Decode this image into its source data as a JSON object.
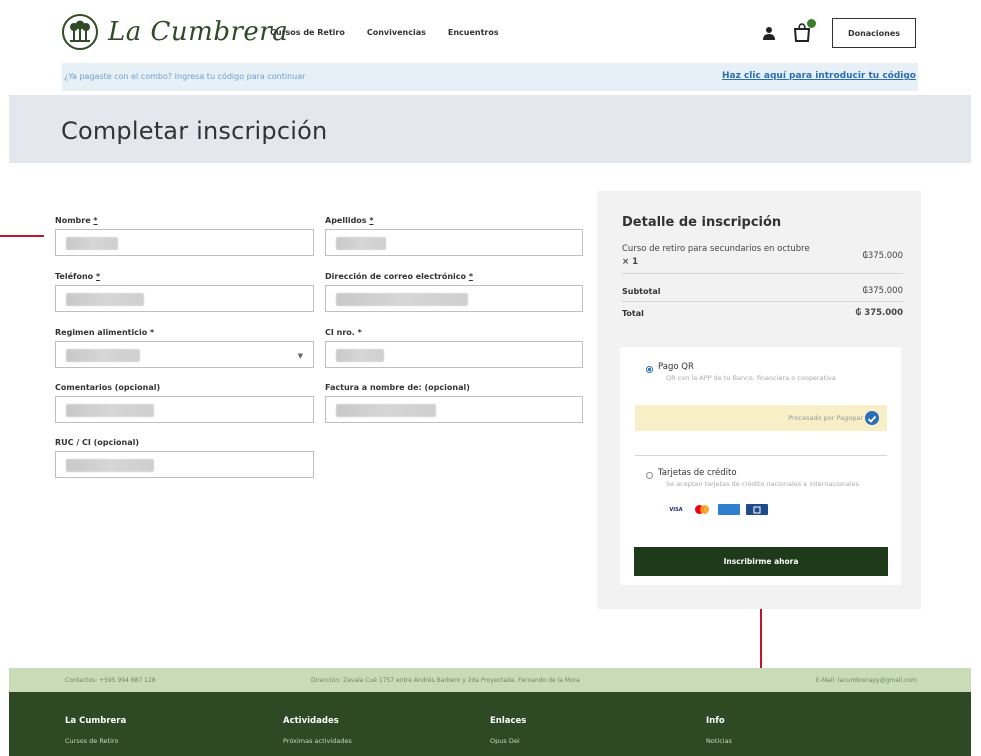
{
  "header": {
    "logo_text": "La Cumbrera",
    "nav": [
      "Cursos de Retiro",
      "Convivencias",
      "Encuentros"
    ],
    "donate_label": "Donaciones"
  },
  "infobar": {
    "message": "¿Ya pagaste con el combo? Ingresa tu código para continuar",
    "link": "Haz clic aquí para introducir tu código"
  },
  "page": {
    "title": "Completar inscripción"
  },
  "form": {
    "fields": [
      {
        "label": "Nombre",
        "required": true
      },
      {
        "label": "Apellidos",
        "required": true
      },
      {
        "label": "Teléfono",
        "required": true
      },
      {
        "label": "Dirección de correo electrónico",
        "required": true
      },
      {
        "label": "Regimen alimenticio",
        "required": true
      },
      {
        "label": "CI nro.",
        "required": true
      },
      {
        "label": "Comentarios (opcional)",
        "required": false
      },
      {
        "label": "Factura a nombre de: (opcional)",
        "required": false
      },
      {
        "label": "RUC / CI (opcional)",
        "required": false
      }
    ],
    "required_mark": "*",
    "select_arrow": "▼"
  },
  "summary": {
    "title": "Detalle de inscripción",
    "item_name": "Curso de retiro para secundarios en octubre",
    "item_qty": "× 1",
    "item_price": "₲375.000",
    "subtotal_label": "Subtotal",
    "subtotal_value": "₲375.000",
    "total_label": "Total",
    "total_value": "₲ 375.000"
  },
  "payment": {
    "options": [
      {
        "title": "Pago QR",
        "description": "QR con la APP de tu Banco, financiera o cooperativa",
        "selected": true
      },
      {
        "title": "Tarjetas de crédito",
        "description": "Se aceptan tarjetas de crédito nacionales e internacionales",
        "selected": false
      }
    ],
    "provider_text": "Procesado por Pagopar",
    "card_brands": [
      "VISA",
      "mastercard",
      "american express",
      "bancard"
    ],
    "submit_label": "Inscribirme ahora"
  },
  "footer": {
    "contact": "Contactos: +595 994 887 128",
    "address": "Dirección: Zavala Cué 1757 entre Andrés Barbero y 2da Proyectada. Fernando de la Mora",
    "email": "E-Mail: lacumbrerapy@gmail.com",
    "columns": [
      {
        "heading": "La Cumbrera",
        "link": "Cursos de Retiro"
      },
      {
        "heading": "Actividades",
        "link": "Próximas actividades"
      },
      {
        "heading": "Enlaces",
        "link": "Opus Dei"
      },
      {
        "heading": "Info",
        "link": "Noticias"
      }
    ]
  },
  "colors": {
    "brand_green": "#2d4a24",
    "button_dark": "#1e3a1a",
    "link_blue": "#2a6fb5",
    "annotation_red": "#c0162c",
    "footer_light": "#c9dcb8"
  }
}
